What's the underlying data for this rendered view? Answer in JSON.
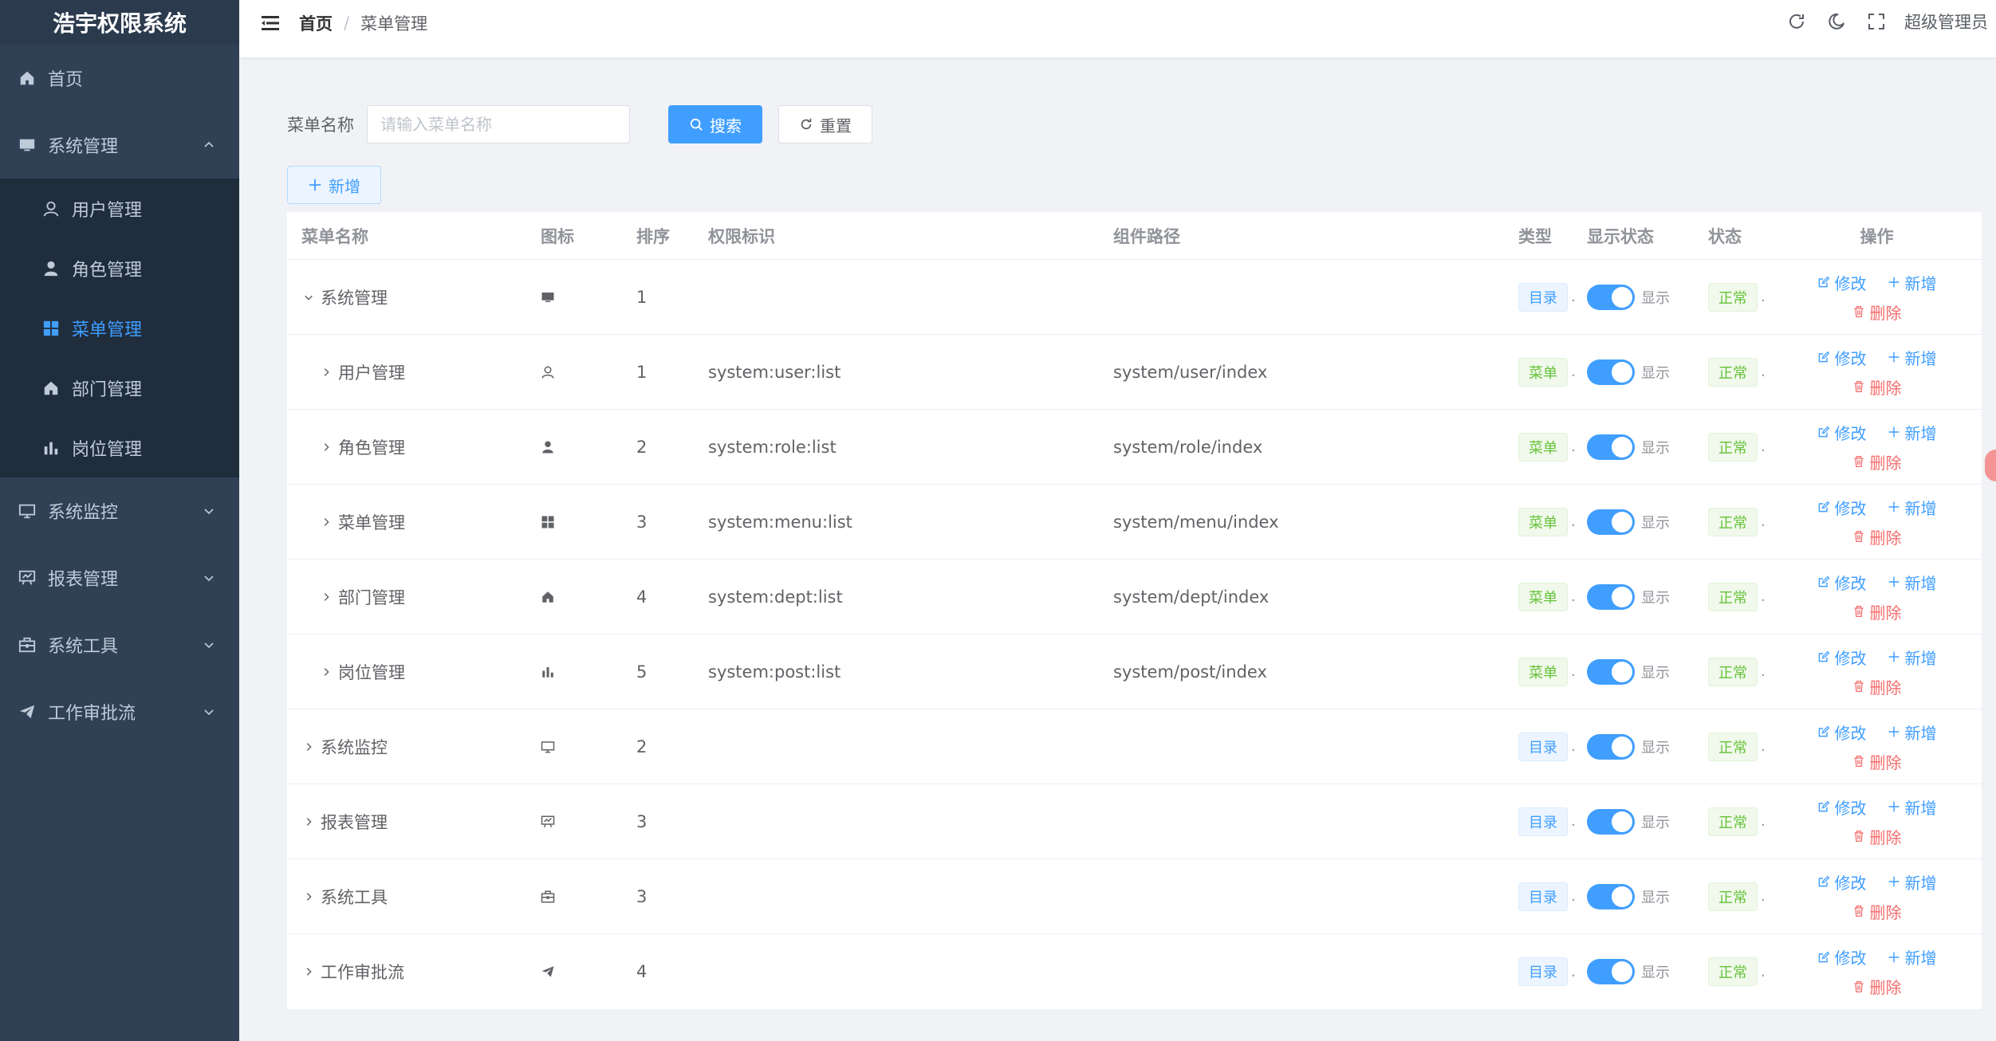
{
  "app": {
    "title": "浩宇权限系统"
  },
  "sidebar": {
    "items": [
      {
        "label": "首页",
        "icon": "home-icon"
      },
      {
        "label": "系统管理",
        "icon": "monitor-icon",
        "expanded": true
      },
      {
        "label": "系统监控",
        "icon": "screen-icon"
      },
      {
        "label": "报表管理",
        "icon": "chart-board-icon"
      },
      {
        "label": "系统工具",
        "icon": "toolbox-icon"
      },
      {
        "label": "工作审批流",
        "icon": "send-icon"
      }
    ],
    "sub_items": [
      {
        "label": "用户管理",
        "icon": "user-icon"
      },
      {
        "label": "角色管理",
        "icon": "user-filled-icon"
      },
      {
        "label": "菜单管理",
        "icon": "grid-icon",
        "active": true
      },
      {
        "label": "部门管理",
        "icon": "home-icon"
      },
      {
        "label": "岗位管理",
        "icon": "bar-chart-icon"
      }
    ]
  },
  "navbar": {
    "breadcrumb_home": "首页",
    "breadcrumb_sep": "/",
    "breadcrumb_current": "菜单管理",
    "user": "超级管理员"
  },
  "search": {
    "label": "菜单名称",
    "placeholder": "请输入菜单名称",
    "search_button": "搜索",
    "reset_button": "重置",
    "add_button": "新增"
  },
  "table": {
    "headers": {
      "name": "菜单名称",
      "icon": "图标",
      "order": "排序",
      "perm": "权限标识",
      "path": "组件路径",
      "type": "类型",
      "visible": "显示状态",
      "status": "状态",
      "ops": "操作"
    },
    "rows": [
      {
        "name": "系统管理",
        "icon": "monitor-icon",
        "order": "1",
        "perm": "",
        "path": "",
        "type": "目录",
        "type_kind": "dir",
        "visible": "显示",
        "status": "正常",
        "level": 0,
        "expanded": true
      },
      {
        "name": "用户管理",
        "icon": "user-icon",
        "order": "1",
        "perm": "system:user:list",
        "path": "system/user/index",
        "type": "菜单",
        "type_kind": "menu",
        "visible": "显示",
        "status": "正常",
        "level": 1
      },
      {
        "name": "角色管理",
        "icon": "user-filled-icon",
        "order": "2",
        "perm": "system:role:list",
        "path": "system/role/index",
        "type": "菜单",
        "type_kind": "menu",
        "visible": "显示",
        "status": "正常",
        "level": 1
      },
      {
        "name": "菜单管理",
        "icon": "grid-icon",
        "order": "3",
        "perm": "system:menu:list",
        "path": "system/menu/index",
        "type": "菜单",
        "type_kind": "menu",
        "visible": "显示",
        "status": "正常",
        "level": 1
      },
      {
        "name": "部门管理",
        "icon": "home-icon",
        "order": "4",
        "perm": "system:dept:list",
        "path": "system/dept/index",
        "type": "菜单",
        "type_kind": "menu",
        "visible": "显示",
        "status": "正常",
        "level": 1
      },
      {
        "name": "岗位管理",
        "icon": "bar-chart-icon",
        "order": "5",
        "perm": "system:post:list",
        "path": "system/post/index",
        "type": "菜单",
        "type_kind": "menu",
        "visible": "显示",
        "status": "正常",
        "level": 1
      },
      {
        "name": "系统监控",
        "icon": "screen-icon",
        "order": "2",
        "perm": "",
        "path": "",
        "type": "目录",
        "type_kind": "dir",
        "visible": "显示",
        "status": "正常",
        "level": 0
      },
      {
        "name": "报表管理",
        "icon": "chart-board-icon",
        "order": "3",
        "perm": "",
        "path": "",
        "type": "目录",
        "type_kind": "dir",
        "visible": "显示",
        "status": "正常",
        "level": 0
      },
      {
        "name": "系统工具",
        "icon": "toolbox-icon",
        "order": "3",
        "perm": "",
        "path": "",
        "type": "目录",
        "type_kind": "dir",
        "visible": "显示",
        "status": "正常",
        "level": 0
      },
      {
        "name": "工作审批流",
        "icon": "send-icon",
        "order": "4",
        "perm": "",
        "path": "",
        "type": "目录",
        "type_kind": "dir",
        "visible": "显示",
        "status": "正常",
        "level": 0
      }
    ],
    "ops": {
      "edit": "修改",
      "add": "新增",
      "delete": "删除"
    }
  },
  "colors": {
    "primary": "#409eff",
    "success": "#67c23a",
    "danger": "#f56c6c",
    "sidebar": "#304156"
  }
}
